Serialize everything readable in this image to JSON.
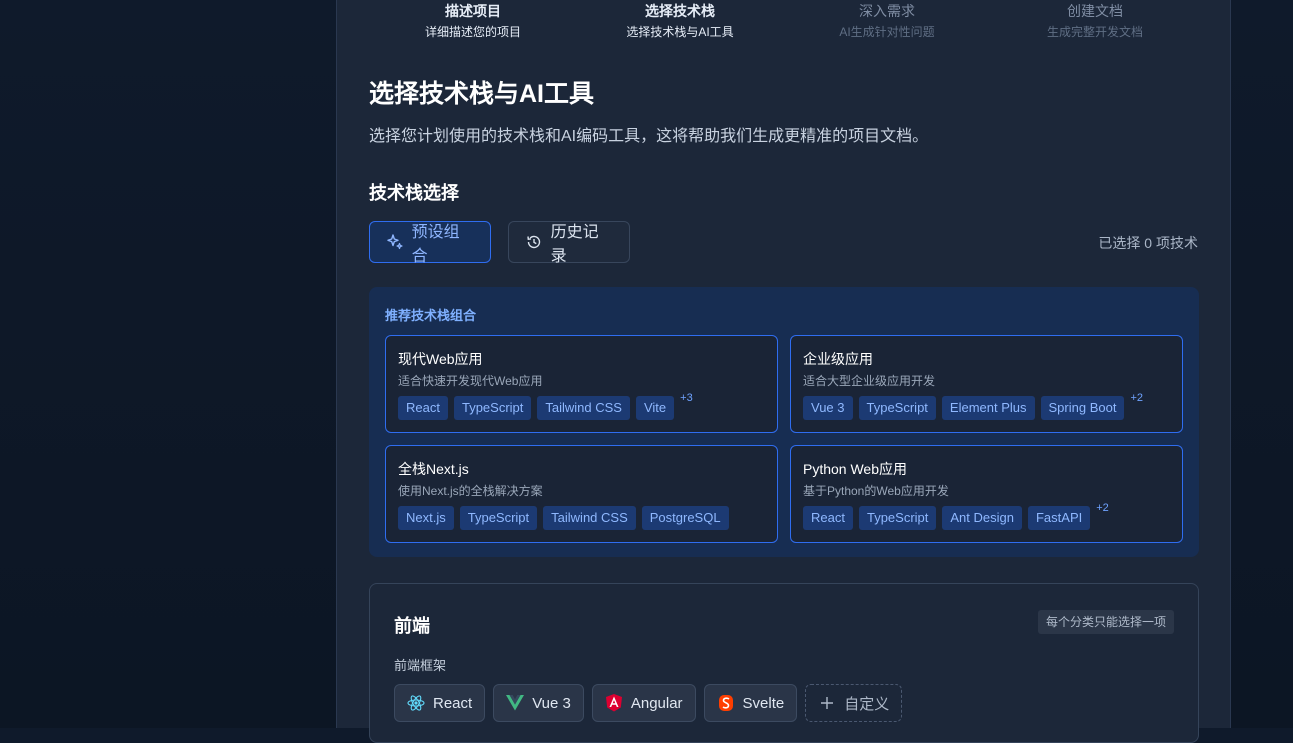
{
  "steps": [
    {
      "title": "描述项目",
      "sub": "详细描述您的项目",
      "state": "done"
    },
    {
      "title": "选择技术栈",
      "sub": "选择技术栈与AI工具",
      "state": "active"
    },
    {
      "title": "深入需求",
      "sub": "AI生成针对性问题",
      "state": "todo"
    },
    {
      "title": "创建文档",
      "sub": "生成完整开发文档",
      "state": "todo"
    }
  ],
  "page": {
    "title": "选择技术栈与AI工具",
    "lead": "选择您计划使用的技术栈和AI编码工具，这将帮助我们生成更精准的项目文档。",
    "section_title": "技术栈选择"
  },
  "tabs": {
    "preset": "预设组合",
    "history": "历史记录",
    "selected_count": "已选择 0 项技术"
  },
  "recommend": {
    "title": "推荐技术栈组合",
    "cards": [
      {
        "name": "现代Web应用",
        "desc": "适合快速开发现代Web应用",
        "tags": [
          "React",
          "TypeScript",
          "Tailwind CSS",
          "Vite"
        ],
        "more": "+3"
      },
      {
        "name": "企业级应用",
        "desc": "适合大型企业级应用开发",
        "tags": [
          "Vue 3",
          "TypeScript",
          "Element Plus",
          "Spring Boot"
        ],
        "more": "+2"
      },
      {
        "name": "全栈Next.js",
        "desc": "使用Next.js的全栈解决方案",
        "tags": [
          "Next.js",
          "TypeScript",
          "Tailwind CSS",
          "PostgreSQL"
        ],
        "more": ""
      },
      {
        "name": "Python Web应用",
        "desc": "基于Python的Web应用开发",
        "tags": [
          "React",
          "TypeScript",
          "Ant Design",
          "FastAPI"
        ],
        "more": "+2"
      }
    ]
  },
  "frontend": {
    "title": "前端",
    "note": "每个分类只能选择一项",
    "subtitle": "前端框架",
    "options": [
      {
        "label": "React",
        "icon": "react-icon"
      },
      {
        "label": "Vue 3",
        "icon": "vue-icon"
      },
      {
        "label": "Angular",
        "icon": "angular-icon"
      },
      {
        "label": "Svelte",
        "icon": "svelte-icon"
      }
    ],
    "custom": "自定义"
  },
  "colors": {
    "accent": "#2f6df0",
    "tag_bg": "#1c3a73",
    "panel_bg": "#1c2739"
  }
}
